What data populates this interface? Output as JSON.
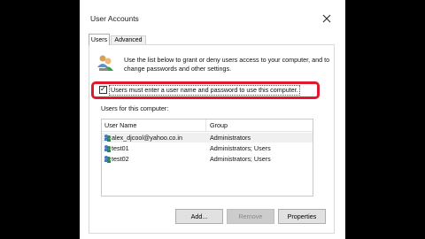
{
  "window": {
    "title": "User Accounts"
  },
  "tabs": [
    {
      "label": "Users"
    },
    {
      "label": "Advanced"
    }
  ],
  "intro": {
    "text": "Use the list below to grant or deny users access to your computer, and to change passwords and other settings."
  },
  "requirement": {
    "label": "Users must enter a user name and password to use this computer.",
    "checked": true,
    "check_glyph": "✓"
  },
  "list": {
    "caption": "Users for this computer:",
    "columns": [
      "User Name",
      "Group"
    ],
    "rows": [
      {
        "user": "alex_djcool@yahoo.co.in",
        "group": "Administrators"
      },
      {
        "user": "test01",
        "group": "Administrators; Users"
      },
      {
        "user": "test02",
        "group": "Administrators; Users"
      }
    ]
  },
  "buttons": {
    "add": "Add...",
    "remove": "Remove",
    "properties": "Properties"
  },
  "colors": {
    "highlight": "#e0182d",
    "background": "#000000"
  }
}
